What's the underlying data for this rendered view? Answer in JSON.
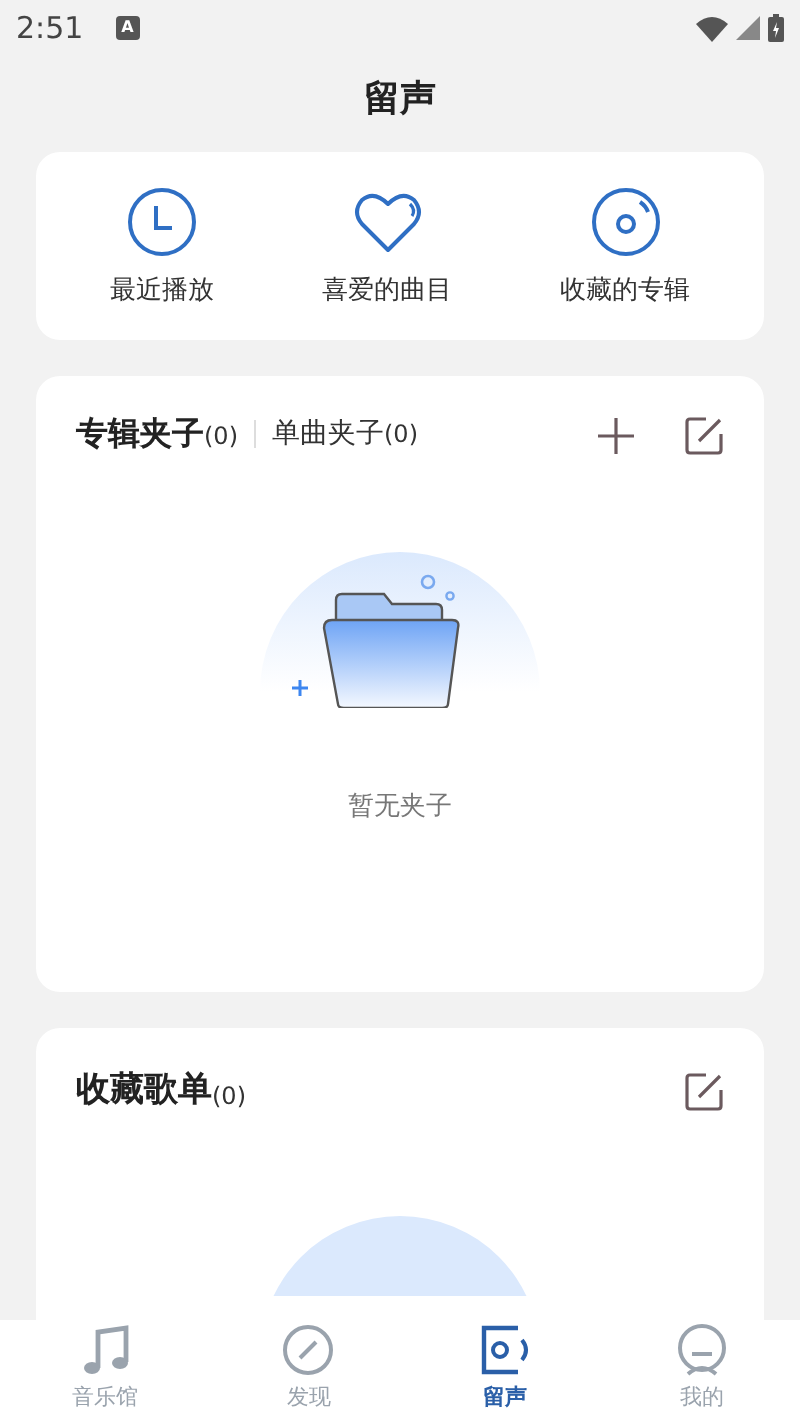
{
  "status_bar": {
    "time": "2:51",
    "notification": "A"
  },
  "header": {
    "title": "留声"
  },
  "shortcuts": [
    {
      "kind": "clock",
      "label": "最近播放"
    },
    {
      "kind": "heart",
      "label": "喜爱的曲目"
    },
    {
      "kind": "disc",
      "label": "收藏的专辑"
    }
  ],
  "folders": {
    "tabs": [
      {
        "label": "专辑夹子",
        "count": "(0)",
        "selected": true
      },
      {
        "label": "单曲夹子",
        "count": "(0)",
        "selected": false
      }
    ],
    "empty_text": "暂无夹子"
  },
  "playlists": {
    "title": "收藏歌单",
    "count": "(0)"
  },
  "bottom_nav": [
    {
      "kind": "music",
      "label": "音乐馆",
      "selected": false
    },
    {
      "kind": "discover",
      "label": "发现",
      "selected": false
    },
    {
      "kind": "radio",
      "label": "留声",
      "selected": true
    },
    {
      "kind": "profile",
      "label": "我的",
      "selected": false
    }
  ]
}
